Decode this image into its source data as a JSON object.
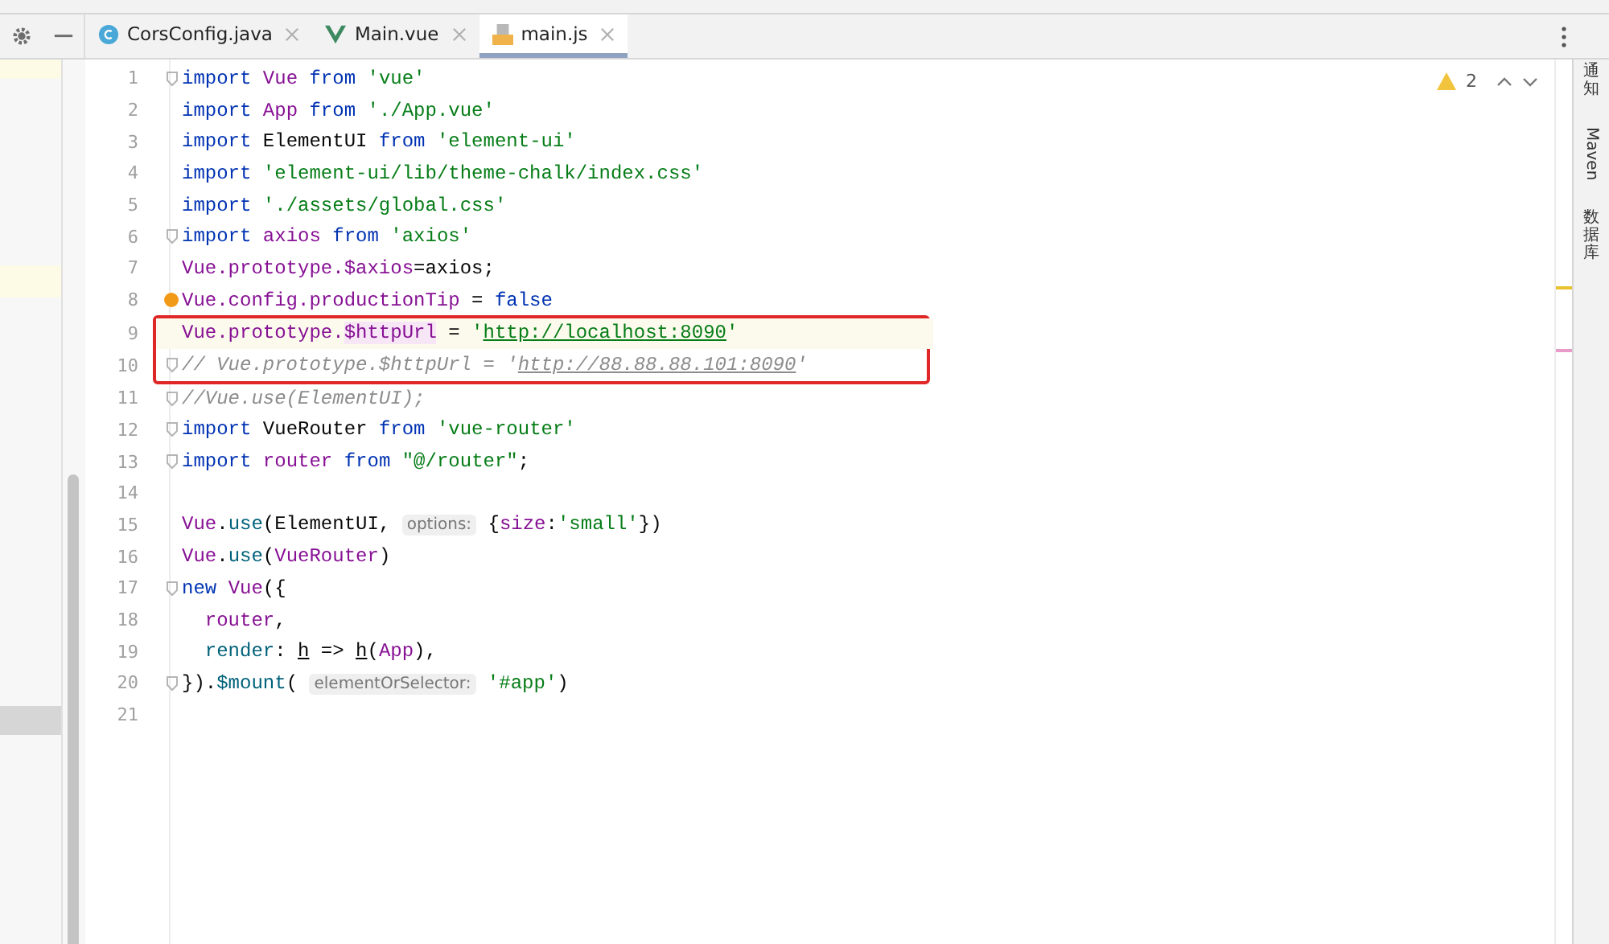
{
  "tabs": [
    {
      "label": "CorsConfig.java",
      "kind": "class",
      "selected": false
    },
    {
      "label": "Main.vue",
      "kind": "vue",
      "selected": false
    },
    {
      "label": "main.js",
      "kind": "js",
      "selected": true
    }
  ],
  "inspections": {
    "warnings": "2"
  },
  "lines": [
    {
      "number": "1",
      "fold": true,
      "current": false,
      "boxed": false,
      "bulb": false,
      "tokens": [
        {
          "t": "import ",
          "kind": "kw"
        },
        {
          "t": "Vue ",
          "kind": "id"
        },
        {
          "t": "from ",
          "kind": "kw"
        },
        {
          "t": "'vue'",
          "kind": "str"
        }
      ]
    },
    {
      "number": "2",
      "fold": false,
      "current": false,
      "boxed": false,
      "bulb": false,
      "tokens": [
        {
          "t": "import ",
          "kind": "kw"
        },
        {
          "t": "App ",
          "kind": "id"
        },
        {
          "t": "from ",
          "kind": "kw"
        },
        {
          "t": "'./App.vue'",
          "kind": "str"
        }
      ]
    },
    {
      "number": "3",
      "fold": false,
      "current": false,
      "boxed": false,
      "bulb": false,
      "tokens": [
        {
          "t": "import",
          "kind": "kw"
        },
        {
          "t": " ElementUI ",
          "kind": "plain"
        },
        {
          "t": "from ",
          "kind": "kw"
        },
        {
          "t": "'element-ui'",
          "kind": "str"
        }
      ]
    },
    {
      "number": "4",
      "fold": false,
      "current": false,
      "boxed": false,
      "bulb": false,
      "tokens": [
        {
          "t": "import ",
          "kind": "kw"
        },
        {
          "t": "'element-ui/lib/theme-chalk/index.css'",
          "kind": "str"
        }
      ]
    },
    {
      "number": "5",
      "fold": false,
      "current": false,
      "boxed": false,
      "bulb": false,
      "tokens": [
        {
          "t": "import ",
          "kind": "kw"
        },
        {
          "t": "'./assets/global.css'",
          "kind": "str"
        }
      ]
    },
    {
      "number": "6",
      "fold": true,
      "current": false,
      "boxed": false,
      "bulb": false,
      "tokens": [
        {
          "t": "import ",
          "kind": "kw"
        },
        {
          "t": "axios ",
          "kind": "id"
        },
        {
          "t": "from ",
          "kind": "kw"
        },
        {
          "t": "'axios'",
          "kind": "str"
        }
      ]
    },
    {
      "number": "7",
      "fold": false,
      "current": false,
      "boxed": false,
      "bulb": false,
      "tokens": [
        {
          "t": "Vue.prototype.$axios",
          "kind": "id"
        },
        {
          "t": "=axios;",
          "kind": "plain"
        }
      ]
    },
    {
      "number": "8",
      "fold": false,
      "current": false,
      "boxed": false,
      "bulb": true,
      "tokens": [
        {
          "t": "Vue.config.productionTip",
          "kind": "id"
        },
        {
          "t": " = ",
          "kind": "plain"
        },
        {
          "t": "false",
          "kind": "kw"
        }
      ]
    },
    {
      "number": "9",
      "fold": false,
      "current": true,
      "boxed": true,
      "bulb": false,
      "tokens": [
        {
          "t": "Vue.prototype.",
          "kind": "id"
        },
        {
          "t": "$httpUrl",
          "kind": "idmark"
        },
        {
          "t": " = ",
          "kind": "plain"
        },
        {
          "t": "'",
          "kind": "str"
        },
        {
          "t": "http://localhost:8090",
          "kind": "link"
        },
        {
          "t": "'",
          "kind": "str"
        }
      ]
    },
    {
      "number": "10",
      "fold": true,
      "current": false,
      "boxed": true,
      "bulb": false,
      "tokens": [
        {
          "t": "// Vue.prototype.$httpUrl = '",
          "kind": "comment"
        },
        {
          "t": "http://88.88.88.101:8090",
          "kind": "commentlink"
        },
        {
          "t": "'",
          "kind": "comment"
        }
      ]
    },
    {
      "number": "11",
      "fold": true,
      "current": false,
      "boxed": false,
      "bulb": false,
      "tokens": [
        {
          "t": "//Vue.use(ElementUI);",
          "kind": "comment"
        }
      ]
    },
    {
      "number": "12",
      "fold": true,
      "current": false,
      "boxed": false,
      "bulb": false,
      "tokens": [
        {
          "t": "import",
          "kind": "kw"
        },
        {
          "t": " VueRouter ",
          "kind": "plain"
        },
        {
          "t": "from ",
          "kind": "kw"
        },
        {
          "t": "'vue-router'",
          "kind": "str"
        }
      ]
    },
    {
      "number": "13",
      "fold": true,
      "current": false,
      "boxed": false,
      "bulb": false,
      "tokens": [
        {
          "t": "import ",
          "kind": "kw"
        },
        {
          "t": "router ",
          "kind": "id"
        },
        {
          "t": "from ",
          "kind": "kw"
        },
        {
          "t": "\"@/router\"",
          "kind": "str"
        },
        {
          "t": ";",
          "kind": "plain"
        }
      ]
    },
    {
      "number": "14",
      "fold": false,
      "current": false,
      "boxed": false,
      "bulb": false
    },
    {
      "number": "15",
      "fold": false,
      "current": false,
      "boxed": false,
      "bulb": false,
      "tokens": [
        {
          "t": "Vue",
          "kind": "id"
        },
        {
          "t": ".",
          "kind": "plain"
        },
        {
          "t": "use",
          "kind": "fn"
        },
        {
          "t": "(ElementUI, ",
          "kind": "plain"
        },
        {
          "t": "options:",
          "kind": "hint"
        },
        {
          "t": " {",
          "kind": "plain"
        },
        {
          "t": "size",
          "kind": "id"
        },
        {
          "t": ":",
          "kind": "plain"
        },
        {
          "t": "'small'",
          "kind": "str"
        },
        {
          "t": "})",
          "kind": "plain"
        }
      ]
    },
    {
      "number": "16",
      "fold": false,
      "current": false,
      "boxed": false,
      "bulb": false,
      "tokens": [
        {
          "t": "Vue",
          "kind": "id"
        },
        {
          "t": ".",
          "kind": "plain"
        },
        {
          "t": "use",
          "kind": "fn"
        },
        {
          "t": "(",
          "kind": "plain"
        },
        {
          "t": "VueRouter",
          "kind": "id"
        },
        {
          "t": ")",
          "kind": "plain"
        }
      ]
    },
    {
      "number": "17",
      "fold": true,
      "current": false,
      "boxed": false,
      "bulb": false,
      "tokens": [
        {
          "t": "new ",
          "kind": "kw"
        },
        {
          "t": "Vue",
          "kind": "id"
        },
        {
          "t": "({",
          "kind": "plain"
        }
      ]
    },
    {
      "number": "18",
      "fold": false,
      "current": false,
      "boxed": false,
      "bulb": false,
      "tokens": [
        {
          "t": "  router",
          "kind": "id"
        },
        {
          "t": ",",
          "kind": "plain"
        }
      ]
    },
    {
      "number": "19",
      "fold": false,
      "current": false,
      "boxed": false,
      "bulb": false,
      "tokens": [
        {
          "t": "  render",
          "kind": "fn"
        },
        {
          "t": ": ",
          "kind": "plain"
        },
        {
          "t": "h",
          "kind": "param"
        },
        {
          "t": " => ",
          "kind": "plain"
        },
        {
          "t": "h",
          "kind": "param"
        },
        {
          "t": "(",
          "kind": "plain"
        },
        {
          "t": "App",
          "kind": "id"
        },
        {
          "t": "),",
          "kind": "plain"
        }
      ]
    },
    {
      "number": "20",
      "fold": true,
      "current": false,
      "boxed": false,
      "bulb": false,
      "tokens": [
        {
          "t": "}).",
          "kind": "plain"
        },
        {
          "t": "$mount",
          "kind": "fn"
        },
        {
          "t": "( ",
          "kind": "plain"
        },
        {
          "t": "elementOrSelector:",
          "kind": "hint"
        },
        {
          "t": " '#app'",
          "kind": "str"
        },
        {
          "t": ")",
          "kind": "plain"
        }
      ]
    },
    {
      "number": "21",
      "fold": false,
      "current": false,
      "boxed": false,
      "bulb": false
    }
  ],
  "right_toolbar": [
    {
      "label": "通知",
      "kind": "cjk"
    },
    {
      "label": "Maven",
      "kind": "latin"
    },
    {
      "label": "数据库",
      "kind": "cjk"
    }
  ]
}
